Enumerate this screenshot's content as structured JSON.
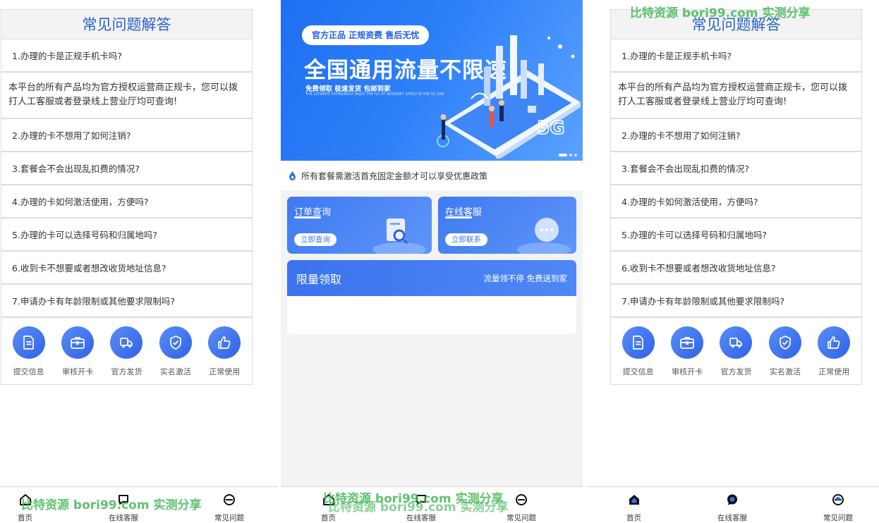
{
  "faq": {
    "title": "常见问题解答",
    "q1": "1.办理的卡是正规手机卡吗?",
    "a1": "本平台的所有产品均为官方授权运营商正规卡，您可以拨打人工客服或者登录线上营业厅均可查询!",
    "q2": "2.办理的卡不想用了如何注销?",
    "q3": "3.套餐会不会出现乱扣费的情况?",
    "q4": "4.办理的卡如何激活使用，方便吗?",
    "q5": "5.办理的卡可以选择号码和归属地吗?",
    "q6": "6.收到卡不想要或者想改收货地址信息?",
    "q7": "7.申请办卡有年龄限制或其他要求限制吗?"
  },
  "steps": [
    {
      "label": "提交信息",
      "icon": "document-icon"
    },
    {
      "label": "审核开卡",
      "icon": "briefcase-icon"
    },
    {
      "label": "官方发货",
      "icon": "delivery-truck-icon"
    },
    {
      "label": "实名激活",
      "icon": "shield-check-icon"
    },
    {
      "label": "正常使用",
      "icon": "thumbs-up-icon"
    }
  ],
  "banner": {
    "pill": "官方正品 正规资费 售后无忧",
    "headline": "全国通用流量不限速",
    "subline": "免费领取 极速发货 包邮到家",
    "tinyline": "THE ULTIMATE EXPERIENCE ENJOY THE 5G OF INTERNET SPEED IN THE 5G ERA",
    "badge": "5G"
  },
  "notice": "所有套餐需激活首充固定金额才可以享受优惠政策",
  "order": {
    "title": "订单查询",
    "button": "立即查询"
  },
  "chat": {
    "title": "在线客服",
    "button": "立即联系"
  },
  "limited": {
    "title": "限量领取",
    "subtitle": "流量领不停 免费送到家"
  },
  "nav": {
    "home": "首页",
    "service": "在线客服",
    "faq": "常见问题"
  },
  "watermark": "比特资源 bori99.com 实测分享",
  "colors": {
    "accent": "#2f63e6",
    "title_blue": "#2a63c7",
    "watermark": "#3cb450"
  }
}
